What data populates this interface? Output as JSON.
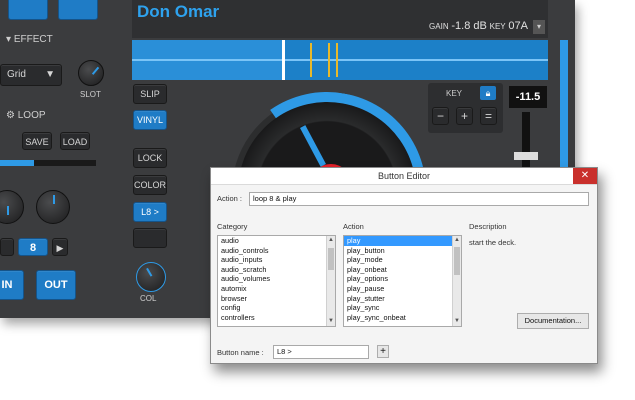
{
  "deck": {
    "track_title": "Don Omar",
    "gain_label": "GAIN",
    "gain_value": "-1.8 dB",
    "key_label": "KEY",
    "key_value": "07A",
    "key_panel_label": "KEY",
    "pitch_value": "-11.5",
    "effect_label": "EFFECT",
    "effect_select": "Grid",
    "slot_label": "SLOT",
    "loop_label": "LOOP",
    "save_label": "SAVE",
    "load_label": "LOAD",
    "loop_size": "8",
    "out_label": "OUT",
    "in_label": "IN",
    "col_label": "COL",
    "side_buttons": [
      "SLIP",
      "VINYL",
      "LOCK",
      "COLOR",
      "L8 >"
    ],
    "key_buttons": [
      "−",
      "+",
      "="
    ],
    "accent": "#2e9ae6"
  },
  "dialog": {
    "title": "Button Editor",
    "close": "✕",
    "action_label": "Action :",
    "action_value": "loop 8 & play",
    "category_header": "Category",
    "action_header": "Action",
    "description_header": "Description",
    "categories": [
      "audio",
      "audio_controls",
      "audio_inputs",
      "audio_scratch",
      "audio_volumes",
      "automix",
      "browser",
      "config",
      "controllers"
    ],
    "actions": [
      "play",
      "play_button",
      "play_mode",
      "play_onbeat",
      "play_options",
      "play_pause",
      "play_stutter",
      "play_sync",
      "play_sync_onbeat"
    ],
    "description_text": "start the deck.",
    "documentation_button": "Documentation...",
    "button_name_label": "Button name :",
    "button_name_value": "L8 >",
    "add_button": "+"
  }
}
